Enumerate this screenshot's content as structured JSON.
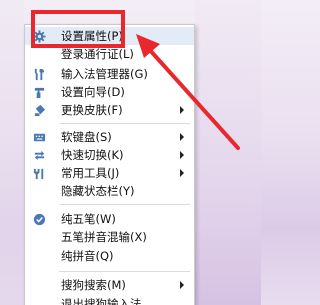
{
  "menu": {
    "items": [
      {
        "label": "设置属性(P)",
        "icon": "gear-icon",
        "submenu": false,
        "highlighted": true
      },
      {
        "label": "登录通行证(L)",
        "icon": "none",
        "submenu": false
      },
      {
        "label": "输入法管理器(G)",
        "icon": "tools-icon",
        "submenu": false
      },
      {
        "label": "设置向导(D)",
        "icon": "wizard-wand-icon",
        "submenu": false
      },
      {
        "label": "更换皮肤(F)",
        "icon": "paint-bucket-icon",
        "submenu": true
      },
      {
        "label": "软键盘(S)",
        "icon": "keyboard-icon",
        "submenu": true
      },
      {
        "label": "快速切换(K)",
        "icon": "switch-arrows-icon",
        "submenu": true
      },
      {
        "label": "常用工具(J)",
        "icon": "wrench-icon",
        "submenu": true
      },
      {
        "label": "隐藏状态栏(Y)",
        "icon": "none",
        "submenu": false
      },
      {
        "label": "纯五笔(W)",
        "icon": "check-circle-icon",
        "submenu": false,
        "checked": true
      },
      {
        "label": "五笔拼音混输(X)",
        "icon": "none",
        "submenu": false
      },
      {
        "label": "纯拼音(Q)",
        "icon": "none",
        "submenu": false
      },
      {
        "label": "搜狗搜索(M)",
        "icon": "none",
        "submenu": true
      },
      {
        "label": "退出搜狗输入法",
        "icon": "none",
        "submenu": false
      }
    ]
  },
  "colors": {
    "highlight": "#e3ecf6",
    "annotation_red": "#e8282d",
    "icon_blue": "#4a78b4"
  }
}
